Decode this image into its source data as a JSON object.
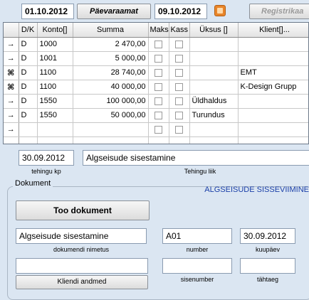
{
  "toolbar": {
    "date_from": "01.10.2012",
    "daybook_label": "Päevaraamat",
    "date_to": "09.10.2012",
    "calendar_icon": "calendar-icon",
    "register_label": "Registrikaa"
  },
  "grid": {
    "headers": {
      "indicator": "",
      "dk": "D/K",
      "konto": "Konto[]",
      "summa": "Summa",
      "maks": "Maks",
      "kass": "Kass",
      "yksus": "Üksus []",
      "klient": "Klient[]..."
    },
    "rows": [
      {
        "indicator": "→",
        "dk": "D",
        "konto": "1000",
        "summa": "2 470,00",
        "yksus": "",
        "klient": ""
      },
      {
        "indicator": "→",
        "dk": "D",
        "konto": "1001",
        "summa": "5 000,00",
        "yksus": "",
        "klient": ""
      },
      {
        "indicator": "⌘",
        "dk": "D",
        "konto": "1100",
        "summa": "28 740,00",
        "yksus": "",
        "klient": "EMT"
      },
      {
        "indicator": "⌘",
        "dk": "D",
        "konto": "1100",
        "summa": "40 000,00",
        "yksus": "",
        "klient": "K-Design Grupp"
      },
      {
        "indicator": "→",
        "dk": "D",
        "konto": "1550",
        "summa": "100 000,00",
        "yksus": "Üldhaldus",
        "klient": ""
      },
      {
        "indicator": "→",
        "dk": "D",
        "konto": "1550",
        "summa": "50 000,00",
        "yksus": "Turundus",
        "klient": ""
      },
      {
        "indicator": "→",
        "dk": "",
        "konto": "",
        "summa": "",
        "yksus": "",
        "klient": ""
      },
      {
        "indicator": "",
        "dk": "",
        "konto": "",
        "summa": "",
        "yksus": "",
        "klient": ""
      }
    ]
  },
  "transaction": {
    "date_value": "30.09.2012",
    "date_label": "tehingu kp",
    "type_value": "Algseisude sisestamine",
    "type_label": "Tehingu liik"
  },
  "document": {
    "group_title": "Dokument",
    "heading": "ALGSEISUDE SISSEVIIMINE",
    "fetch_button": "Too dokument",
    "name_value": "Algseisude sisestamine",
    "name_label": "dokumendi nimetus",
    "number_value": "A01",
    "number_label": "number",
    "date_value": "30.09.2012",
    "date_label": "kuupäev",
    "client_value": "",
    "client_button": "Kliendi andmed",
    "inner_number_value": "",
    "inner_number_label": "sisenumber",
    "due_value": "",
    "due_label": "tähtaeg"
  },
  "colors": {
    "background": "#dbe6f2",
    "heading": "#1a3fa8",
    "calendar_icon": "#e8852a"
  }
}
